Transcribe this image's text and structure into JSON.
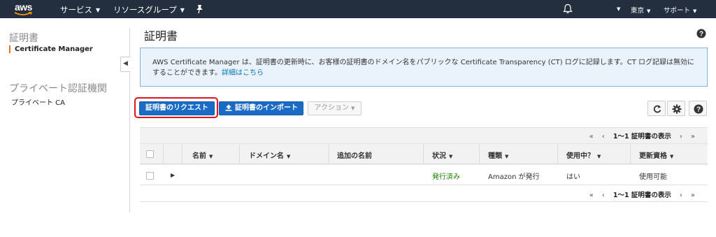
{
  "nav": {
    "logo": "aws",
    "services": "サービス",
    "resource_groups": "リソースグループ",
    "region": "東京",
    "support": "サポート"
  },
  "sidebar": {
    "section1_heading": "証明書",
    "section1_item": "Certificate Manager",
    "section2_heading": "プライベート認証機関",
    "section2_item": "プライベート CA"
  },
  "main": {
    "title": "証明書",
    "info_text": "AWS Certificate Manager は、証明書の更新時に、お客様の証明書のドメイン名をパブリックな Certificate Transparency (CT) ログに記録します。CT ログ記録は無効にすることができます。",
    "info_link": "詳細はこちら",
    "request_button": "証明書のリクエスト",
    "import_button": "証明書のインポート",
    "action_button": "アクション"
  },
  "pagination": {
    "label": "1〜1 証明書の表示",
    "first": "«",
    "prev": "‹",
    "next": "›",
    "last": "»"
  },
  "table": {
    "columns": [
      "名前",
      "ドメイン名",
      "追加の名前",
      "状況",
      "種類",
      "使用中？",
      "更新資格"
    ],
    "rows": [
      {
        "name": "",
        "domain": "",
        "additional": "",
        "status": "発行済み",
        "type": "Amazon が発行",
        "in_use": "はい",
        "renewal": "使用可能"
      }
    ]
  },
  "colors": {
    "nav_bg": "#232f3e",
    "primary": "#1a6bc6",
    "highlight": "#e0141e",
    "status_green": "#1d8102",
    "accent": "#ec7211"
  }
}
